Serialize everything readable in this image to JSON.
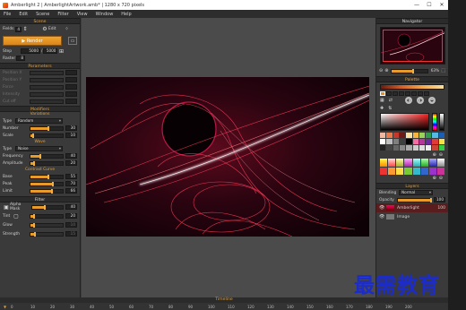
{
  "window": {
    "title": "Amberlight 2 | AmberlightArtwork.amb* | 1280 x 720 pixels",
    "min": "—",
    "max": "☐",
    "close": "✕"
  },
  "menu": [
    "File",
    "Edit",
    "Scene",
    "Filter",
    "View",
    "Window",
    "Help"
  ],
  "scene": {
    "title": "Scene",
    "fields_label": "Fields",
    "fields_value": "4",
    "edit_label": "Edit",
    "render_label": "Render",
    "step_label": "Step",
    "step_value": "5000",
    "step_sep": "/",
    "step_max": "5000",
    "raster_label": "Raster",
    "raster_value": "8"
  },
  "parameters": {
    "title": "Parameters",
    "items": [
      "Position X",
      "Position Y",
      "Force",
      "Intensity",
      "Cut off"
    ]
  },
  "modifiers": {
    "title": "Modifiers",
    "variations": {
      "title": "Variations",
      "type_label": "Type",
      "type_value": "Random",
      "rows": [
        {
          "label": "Number",
          "value": "30",
          "level": 0.55
        },
        {
          "label": "Scale",
          "value": "10",
          "level": 0.08
        }
      ]
    },
    "wave": {
      "title": "Wave",
      "type_label": "Type",
      "type_value": "Noise",
      "rows": [
        {
          "label": "Frequency",
          "value": "40",
          "level": 0.3
        },
        {
          "label": "Amplitude",
          "value": "20",
          "level": 0.12
        }
      ]
    },
    "contrast": {
      "title": "Contrast Curve",
      "rows": [
        {
          "label": "Base",
          "value": "55",
          "level": 0.55
        },
        {
          "label": "Peak",
          "value": "70",
          "level": 0.7
        },
        {
          "label": "Limit",
          "value": "66",
          "level": 0.66
        }
      ]
    }
  },
  "filter": {
    "title": "Filter",
    "rows": [
      {
        "label": "Alpha Mask",
        "value": "40",
        "level": 0.4
      },
      {
        "label": "Tint",
        "value": "20",
        "level": 0.1
      },
      {
        "label": "Glow",
        "value": "10",
        "level": 0.1
      },
      {
        "label": "Strength",
        "value": "15",
        "level": 0.15
      }
    ]
  },
  "navigator": {
    "title": "Navigator",
    "zoom": "63%"
  },
  "palette": {
    "title": "Palette"
  },
  "layers": {
    "title": "Layers",
    "blending_label": "Blending",
    "blending_value": "Normal",
    "opacity_label": "Opacity",
    "opacity_value": "100",
    "opacity_level": 1.0,
    "items": [
      {
        "name": "Amberlight",
        "value": "100"
      },
      {
        "name": "Image",
        "value": ""
      }
    ]
  },
  "timeline": {
    "title": "Timeline",
    "ticks": [
      "0",
      "10",
      "20",
      "30",
      "40",
      "50",
      "60",
      "70",
      "80",
      "90",
      "100",
      "110",
      "120",
      "130",
      "140",
      "150",
      "160",
      "170",
      "180",
      "190",
      "200"
    ]
  },
  "watermark": "最需教育",
  "colors": {
    "accent": "#e89b2a",
    "panel": "#3a3a3a",
    "canvas_bg": "#4b4b4b"
  }
}
